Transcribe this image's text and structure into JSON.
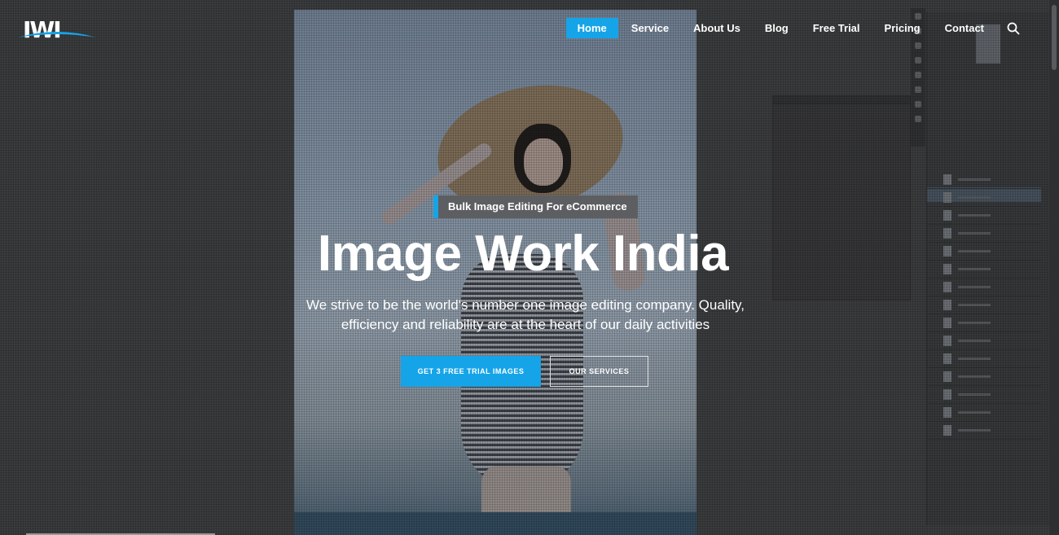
{
  "brand": {
    "logo_text": "IWI",
    "accent": "#16a4e8"
  },
  "nav": {
    "items": [
      {
        "label": "Home",
        "active": true
      },
      {
        "label": "Service"
      },
      {
        "label": "About Us"
      },
      {
        "label": "Blog"
      },
      {
        "label": "Free Trial"
      },
      {
        "label": "Pricing"
      },
      {
        "label": "Contact"
      }
    ],
    "search_icon": "search-icon"
  },
  "hero": {
    "tag": "Bulk Image Editing For eCommerce",
    "title": "Image Work India",
    "subtitle": "We strive to be the world's number one image editing company. Quality, efficiency and reliability are at the heart of our daily activities",
    "primary_button": "GET 3 FREE TRIAL IMAGES",
    "secondary_button": "OUR SERVICES"
  }
}
